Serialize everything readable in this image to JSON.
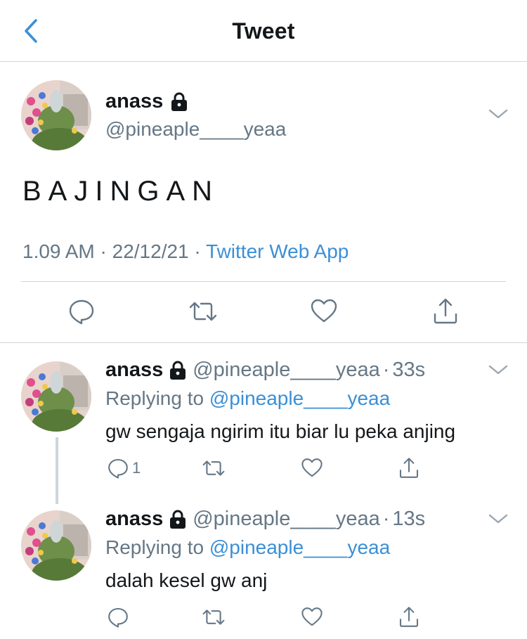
{
  "header": {
    "title": "Tweet"
  },
  "main_tweet": {
    "name": "anass",
    "handle": "@pineaple____yeaa",
    "text": "BAJINGAN",
    "time": "1.09 AM",
    "date": "22/12/21",
    "separator": "·",
    "app": "Twitter Web App",
    "locked": true
  },
  "replies": [
    {
      "name": "anass",
      "handle": "@pineaple____yeaa",
      "separator": "·",
      "time": "33s",
      "replying_label": "Replying to",
      "replying_to": "@pineaple____yeaa",
      "text": "gw sengaja ngirim itu biar lu peka anjing",
      "reply_count": "1"
    },
    {
      "name": "anass",
      "handle": "@pineaple____yeaa",
      "separator": "·",
      "time": "13s",
      "replying_label": "Replying to",
      "replying_to": "@pineaple____yeaa",
      "text": "dalah kesel gw anj",
      "reply_count": ""
    }
  ],
  "colors": {
    "link": "#3b8fd6",
    "muted": "#657786",
    "icon": "#657786",
    "back": "#3b8fd6"
  },
  "icons": [
    "chevron-left-icon",
    "lock-icon",
    "chevron-down-icon",
    "reply-icon",
    "retweet-icon",
    "like-icon",
    "share-icon"
  ]
}
